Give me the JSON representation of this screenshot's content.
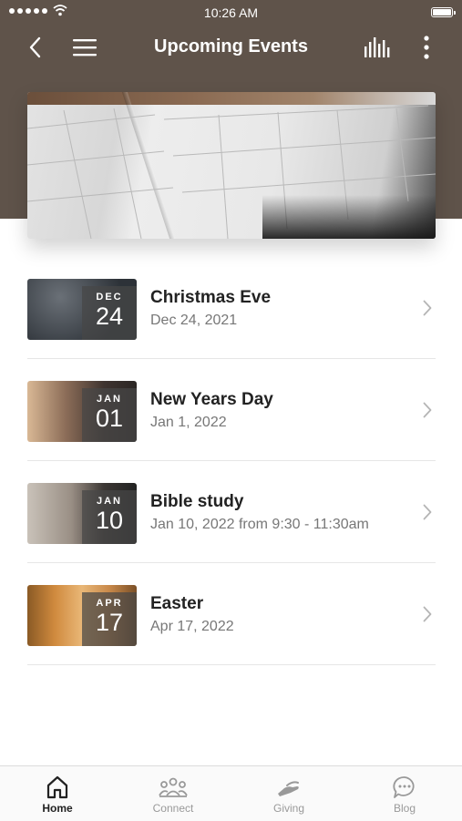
{
  "status_bar": {
    "time": "10:26 AM"
  },
  "header": {
    "title": "Upcoming Events",
    "background_color": "#5f534a"
  },
  "icons": {
    "back": "chevron-left-icon",
    "menu": "hamburger-menu-icon",
    "audio": "audio-bars-icon",
    "more": "more-vertical-icon"
  },
  "events": [
    {
      "month": "DEC",
      "day": "24",
      "title": "Christmas Eve",
      "date": "Dec 24, 2021"
    },
    {
      "month": "JAN",
      "day": "01",
      "title": "New Years Day",
      "date": "Jan 1, 2022"
    },
    {
      "month": "JAN",
      "day": "10",
      "title": "Bible study",
      "date": "Jan 10, 2022 from 9:30 - 11:30am"
    },
    {
      "month": "APR",
      "day": "17",
      "title": "Easter",
      "date": "Apr 17, 2022"
    }
  ],
  "tabs": [
    {
      "label": "Home",
      "icon": "home-icon",
      "active": true
    },
    {
      "label": "Connect",
      "icon": "people-icon",
      "active": false
    },
    {
      "label": "Giving",
      "icon": "giving-hand-icon",
      "active": false
    },
    {
      "label": "Blog",
      "icon": "chat-bubble-icon",
      "active": false
    }
  ],
  "colors": {
    "accent_text": "#222222",
    "muted_text": "#777777",
    "tab_inactive": "#999999"
  }
}
